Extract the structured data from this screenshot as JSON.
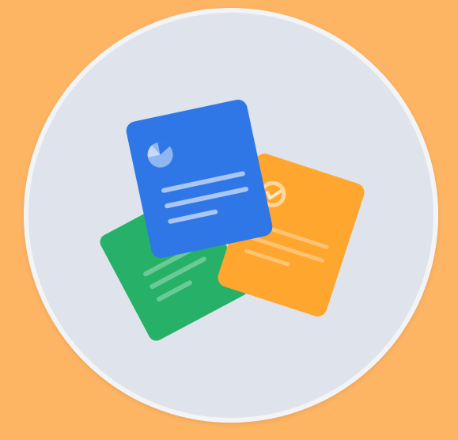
{
  "colors": {
    "background": "#fdb463",
    "circle": "#dfe4ec",
    "circle_ring": "#f3f4f6",
    "blue_card": "#2f77e6",
    "green_card": "#27b067",
    "orange_card": "#ffa62e",
    "line_light": "#a9c7f4"
  },
  "icons": {
    "blue_card": "pie-chart-icon",
    "orange_card": "checkmark-icon"
  }
}
